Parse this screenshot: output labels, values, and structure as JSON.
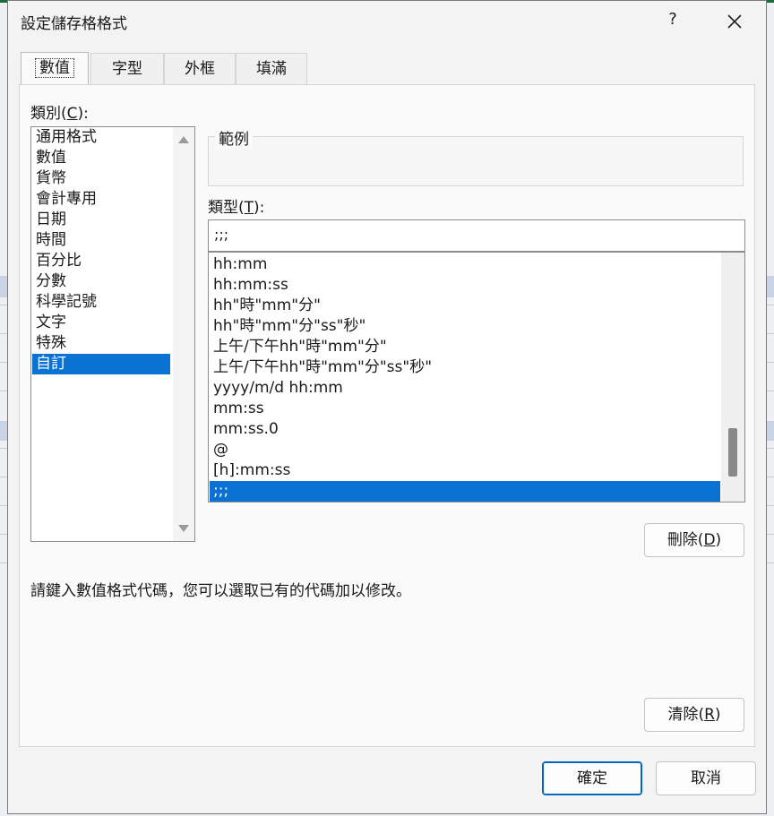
{
  "dialog": {
    "title": "設定儲存格格式",
    "help_label": "?"
  },
  "tabs": [
    {
      "label": "數值",
      "active": true
    },
    {
      "label": "字型",
      "active": false
    },
    {
      "label": "外框",
      "active": false
    },
    {
      "label": "填滿",
      "active": false
    }
  ],
  "category": {
    "label_prefix": "類別(",
    "label_key": "C",
    "label_suffix": "):",
    "items": [
      "通用格式",
      "數值",
      "貨幣",
      "會計專用",
      "日期",
      "時間",
      "百分比",
      "分數",
      "科學記號",
      "文字",
      "特殊",
      "自訂"
    ],
    "selected": "自訂"
  },
  "sample": {
    "legend": "範例",
    "value": ""
  },
  "type": {
    "label_prefix": "類型(",
    "label_key": "T",
    "label_suffix": "):",
    "value": ";;;",
    "formats": [
      "hh:mm",
      "hh:mm:ss",
      "hh\"時\"mm\"分\"",
      "hh\"時\"mm\"分\"ss\"秒\"",
      "上午/下午hh\"時\"mm\"分\"",
      "上午/下午hh\"時\"mm\"分\"ss\"秒\"",
      "yyyy/m/d hh:mm",
      "mm:ss",
      "mm:ss.0",
      "@",
      "[h]:mm:ss",
      ";;;"
    ],
    "selected": ";;;"
  },
  "buttons": {
    "delete_prefix": "刪除(",
    "delete_key": "D",
    "delete_suffix": ")",
    "clear_prefix": "清除(",
    "clear_key": "R",
    "clear_suffix": ")",
    "ok": "確定",
    "cancel": "取消"
  },
  "description": "請鍵入數值格式代碼，您可以選取已有的代碼加以修改。",
  "colors": {
    "selection": "#0a72d2",
    "primary_border": "#0067c0"
  }
}
